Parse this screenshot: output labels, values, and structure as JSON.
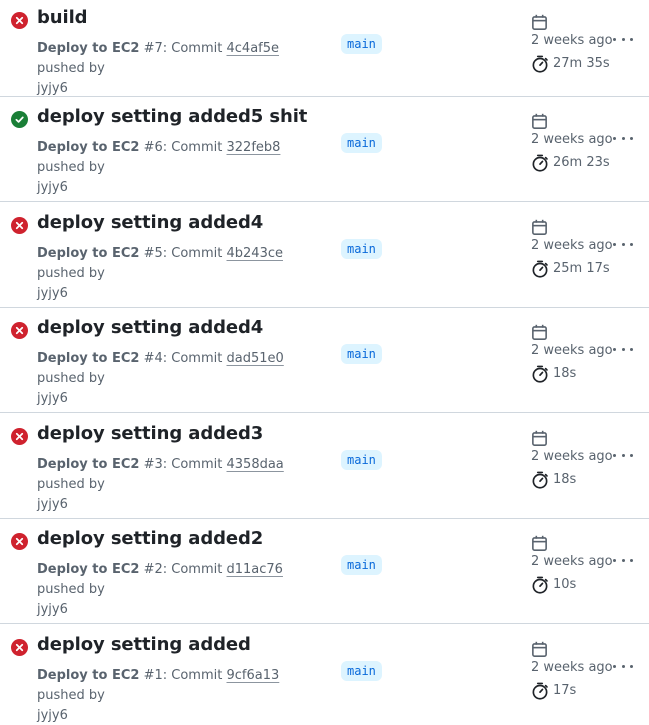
{
  "runs": [
    {
      "status": "failure",
      "title": "build",
      "workflow": "Deploy to EC2",
      "run_number": "#7",
      "commit_prefix": "Commit",
      "sha": "4c4af5e",
      "pushed_by_text": "pushed by",
      "user": "jyjy6",
      "branch": "main",
      "when": "2 weeks ago",
      "duration": "27m 35s"
    },
    {
      "status": "success",
      "title": "deploy setting added5 shit",
      "workflow": "Deploy to EC2",
      "run_number": "#6",
      "commit_prefix": "Commit",
      "sha": "322feb8",
      "pushed_by_text": "pushed by",
      "user": "jyjy6",
      "branch": "main",
      "when": "2 weeks ago",
      "duration": "26m 23s"
    },
    {
      "status": "failure",
      "title": "deploy setting added4",
      "workflow": "Deploy to EC2",
      "run_number": "#5",
      "commit_prefix": "Commit",
      "sha": "4b243ce",
      "pushed_by_text": "pushed by",
      "user": "jyjy6",
      "branch": "main",
      "when": "2 weeks ago",
      "duration": "25m 17s"
    },
    {
      "status": "failure",
      "title": "deploy setting added4",
      "workflow": "Deploy to EC2",
      "run_number": "#4",
      "commit_prefix": "Commit",
      "sha": "dad51e0",
      "pushed_by_text": "pushed by",
      "user": "jyjy6",
      "branch": "main",
      "when": "2 weeks ago",
      "duration": "18s"
    },
    {
      "status": "failure",
      "title": "deploy setting added3",
      "workflow": "Deploy to EC2",
      "run_number": "#3",
      "commit_prefix": "Commit",
      "sha": "4358daa",
      "pushed_by_text": "pushed by",
      "user": "jyjy6",
      "branch": "main",
      "when": "2 weeks ago",
      "duration": "18s"
    },
    {
      "status": "failure",
      "title": "deploy setting added2",
      "workflow": "Deploy to EC2",
      "run_number": "#2",
      "commit_prefix": "Commit",
      "sha": "d11ac76",
      "pushed_by_text": "pushed by",
      "user": "jyjy6",
      "branch": "main",
      "when": "2 weeks ago",
      "duration": "10s"
    },
    {
      "status": "failure",
      "title": "deploy setting added",
      "workflow": "Deploy to EC2",
      "run_number": "#1",
      "commit_prefix": "Commit",
      "sha": "9cf6a13",
      "pushed_by_text": "pushed by",
      "user": "jyjy6",
      "branch": "main",
      "when": "2 weeks ago",
      "duration": "17s"
    }
  ],
  "icons": {
    "failure": "x-circle-fill-icon",
    "success": "check-circle-fill-icon",
    "calendar": "calendar-icon",
    "duration": "stopwatch-icon",
    "menu": "kebab-horizontal-icon"
  },
  "colors": {
    "failure": "#cf222e",
    "success": "#1a7f37",
    "branch_bg": "#ddf4ff",
    "branch_fg": "#0969da",
    "muted": "#59636e"
  }
}
